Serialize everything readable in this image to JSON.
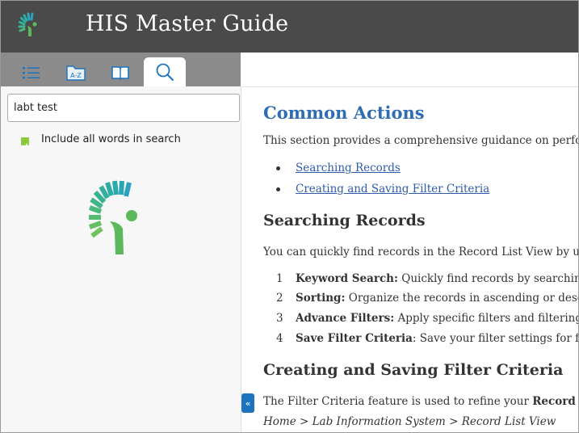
{
  "header": {
    "title": "HIS Master Guide"
  },
  "tabs": [
    {
      "name": "tab-contents",
      "icon": "list-icon"
    },
    {
      "name": "tab-index",
      "icon": "a-z-index-icon",
      "label": "A-Z"
    },
    {
      "name": "tab-glossary",
      "icon": "book-icon"
    },
    {
      "name": "tab-search",
      "icon": "search-icon",
      "active": true
    }
  ],
  "sidebar": {
    "search_value": "labt test",
    "include_all_words_label": "Include all words in search",
    "include_all_words_checked": true
  },
  "content": {
    "title": "Common Actions",
    "intro": "This section provides a comprehensive guidance on performing",
    "links": [
      "Searching Records",
      "Creating and Saving Filter Criteria"
    ],
    "section1_title": "Searching Records",
    "section1_text": "You can quickly find records in the Record List View by using th",
    "items": [
      {
        "num": "1",
        "bold": "Keyword Search:",
        "text": " Quickly find records by searching for l"
      },
      {
        "num": "2",
        "bold": "Sorting:",
        "text": " Organize the records in ascending or descendin"
      },
      {
        "num": "3",
        "bold": "Advance Filters:",
        "text": " Apply specific filters and filtering logic"
      },
      {
        "num": "4",
        "bold": "Save Filter Criteria",
        "text": ": Save your filter settings for future u"
      }
    ],
    "section2_title": "Creating and Saving Filter Criteria",
    "section2_text": "The Filter Criteria feature is used to refine your ",
    "section2_bold": "Record List Vi",
    "breadcrumb": "Home > Lab Information System > Record List View"
  },
  "collapse_label": "«",
  "colors": {
    "header_bg": "#4a4a4a",
    "tabbar_bg": "#8b8b8b",
    "heading_blue": "#2e6db3",
    "link_blue": "#2e5ca8",
    "logo_green": "#5cb85c",
    "logo_teal": "#2bb3a0",
    "button_blue": "#1e73be"
  }
}
